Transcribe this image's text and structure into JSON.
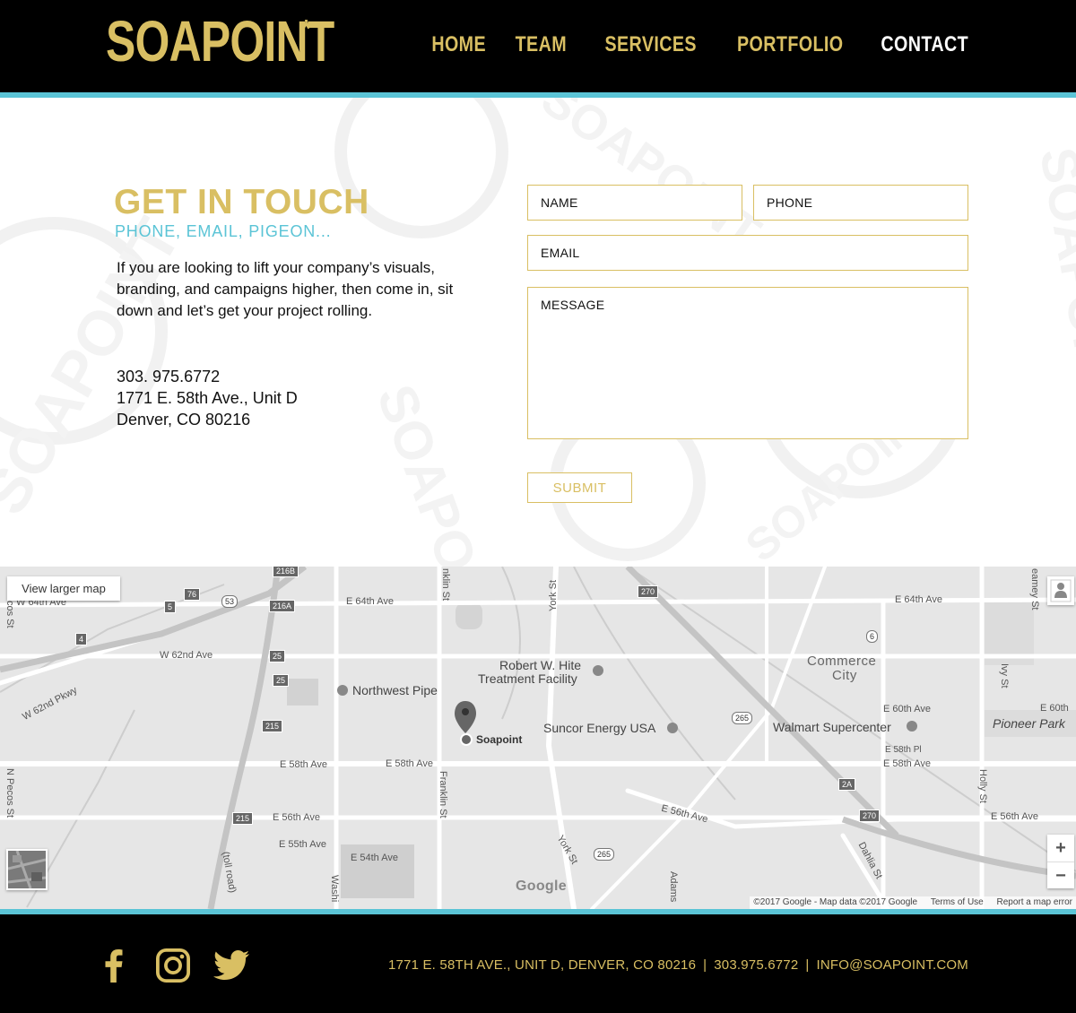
{
  "brand": {
    "logo": "SOAPOINT",
    "logo_mark": "*"
  },
  "nav": [
    {
      "label": "HOME"
    },
    {
      "label": "TEAM"
    },
    {
      "label": "SERVICES"
    },
    {
      "label": "PORTFOLIO"
    },
    {
      "label": "CONTACT",
      "active": true
    }
  ],
  "contact": {
    "heading": "GET IN TOUCH",
    "subheading": "PHONE, EMAIL, PIGEON...",
    "intro": "If you are looking to lift your company’s visuals, branding, and campaigns higher, then come in, sit down and let’s get your project rolling.",
    "phone": "303. 975.6772",
    "address_line1": "1771 E. 58th Ave., Unit D",
    "address_line2": "Denver, CO 80216"
  },
  "form": {
    "name_placeholder": "NAME",
    "phone_placeholder": "PHONE",
    "email_placeholder": "EMAIL",
    "message_placeholder": "MESSAGE",
    "submit_label": "SUBMIT"
  },
  "map": {
    "view_larger": "View larger map",
    "pin_label": "Soapoint",
    "google_logo": "Google",
    "zoom_in": "+",
    "zoom_out": "−",
    "attribution": {
      "data": "©2017 Google - Map data ©2017 Google",
      "terms": "Terms of Use",
      "report": "Report a map error"
    },
    "labels": {
      "e64th_a": "E 64th Ave",
      "e64th_b": "E 64th Ave",
      "w64th": "W 64th Ave",
      "w62nd": "W 62nd Ave",
      "w62nd_pkwy": "W 62nd Pkwy",
      "robert_hite_1": "Robert W. Hite",
      "robert_hite_2": "Treatment Facility",
      "northwest_pipe": "Northwest Pipe",
      "suncor": "Suncor Energy USA",
      "walmart": "Walmart Supercenter",
      "commerce_1": "Commerce",
      "commerce_2": "City",
      "pioneer_park": "Pioneer Park",
      "e60th": "E 60th Ave",
      "e60th_right": "E 60th",
      "e58th_pl": "E 58th Pl",
      "e58th_a": "E 58th Ave",
      "e58th_b": "E 58th Ave",
      "e58th_c": "E 58th Ave",
      "e56th_a": "E 56th Ave",
      "e56th_b": "E 56th Ave",
      "e56th_c": "E 56th Ave",
      "e55th": "E 55th Ave",
      "e54th": "E 54th Ave",
      "franklin_a": "Franklin St",
      "franklin_b": "nklin St",
      "york_a": "York St",
      "york_b": "York St",
      "n_pecos": "N Pecos St",
      "pecos_top": "cos St",
      "holly": "Holly St",
      "ivy": "Ivy St",
      "quebec": "eamey St",
      "dahlia": "Dahlia St",
      "adams": "Adams",
      "washington": "Washi",
      "toll_road": "(toll road)"
    },
    "shields": {
      "i76": "76",
      "r53": "53",
      "r5": "5",
      "r4": "4",
      "i25a": "25",
      "i25b": "25",
      "r216b": "216B",
      "r216a": "216A",
      "r215a": "215",
      "r215b": "215",
      "i270a": "270",
      "i270b": "270",
      "r265a": "265",
      "r265b": "265",
      "r6": "6",
      "r2a": "2A"
    }
  },
  "footer": {
    "social": [
      "facebook-icon",
      "instagram-icon",
      "twitter-icon"
    ],
    "address": "1771 E. 58TH AVE., UNIT D, DENVER, CO 80216",
    "separator": "|",
    "phone": "303.975.6772",
    "email": "INFO@SOAPOINT.COM"
  },
  "colors": {
    "gold": "#d9bf63",
    "teal": "#5bc4d6",
    "black": "#000000"
  }
}
